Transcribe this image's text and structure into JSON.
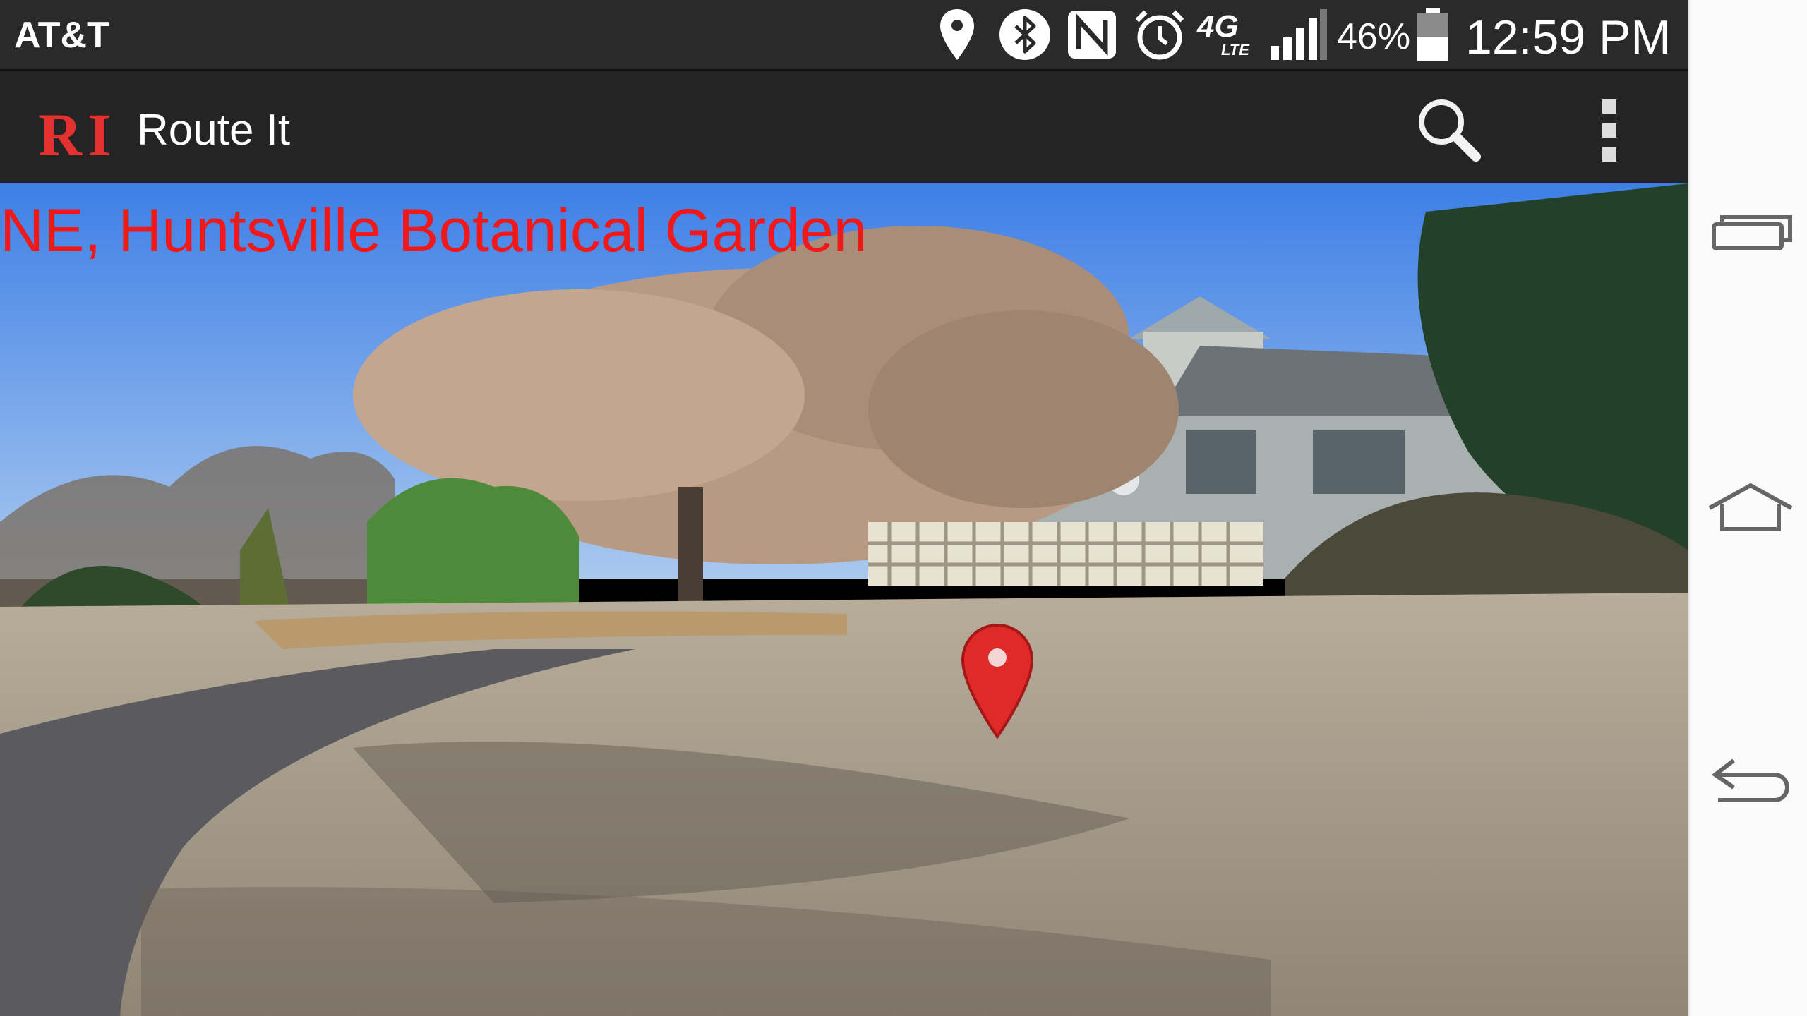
{
  "status_bar": {
    "carrier": "AT&T",
    "icons": [
      "location-icon",
      "bluetooth-icon",
      "nfc-icon",
      "alarm-icon",
      "4g-lte-icon",
      "signal-icon",
      "battery-icon"
    ],
    "network_label": "4G",
    "network_sublabel": "LTE",
    "battery_percent": "46%",
    "time": "12:59 PM"
  },
  "action_bar": {
    "logo": "RI",
    "title": "Route It",
    "actions": [
      "search-icon",
      "overflow-menu-icon"
    ]
  },
  "camera": {
    "ar_label": "NE, Huntsville Botanical Garden",
    "marker_icon": "map-pin-icon",
    "marker_color": "#e02a2a"
  },
  "nav_bar": {
    "buttons": [
      "recent-apps-icon",
      "home-icon",
      "back-icon"
    ]
  },
  "colors": {
    "status_bar": "#2a2a2a",
    "action_bar": "#242424",
    "accent": "#e53030",
    "ar_text": "#f01818",
    "nav_bar": "#fbfbfb"
  }
}
